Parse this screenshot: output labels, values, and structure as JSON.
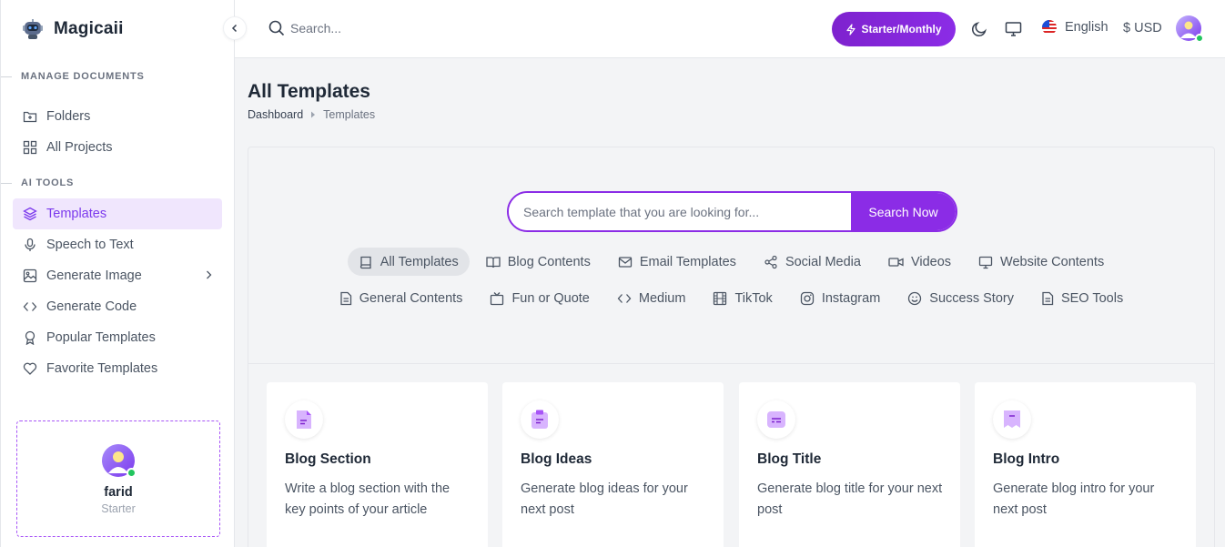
{
  "brand": {
    "name": "Magicaii"
  },
  "sidebar": {
    "section_documents": "MANAGE DOCUMENTS",
    "documents": [
      {
        "label": "Folders",
        "icon": "folder-plus-icon"
      },
      {
        "label": "All Projects",
        "icon": "grid-icon"
      }
    ],
    "section_ai_tools": "AI TOOLS",
    "tools": [
      {
        "label": "Templates",
        "icon": "layers-icon",
        "active": true
      },
      {
        "label": "Speech to Text",
        "icon": "microphone-icon"
      },
      {
        "label": "Generate Image",
        "icon": "image-icon"
      },
      {
        "label": "Generate Code",
        "icon": "code-icon"
      },
      {
        "label": "Popular Templates",
        "icon": "award-icon"
      },
      {
        "label": "Favorite Templates",
        "icon": "heart-icon"
      }
    ],
    "user": {
      "name": "farid",
      "plan": "Starter"
    }
  },
  "topbar": {
    "search_placeholder": "Search...",
    "plan_button": "Starter/Monthly",
    "language": "English",
    "currency": "$ USD"
  },
  "page": {
    "title": "All Templates",
    "breadcrumb_home": "Dashboard",
    "breadcrumb_current": "Templates"
  },
  "template_search": {
    "placeholder": "Search template that you are looking for...",
    "button": "Search Now"
  },
  "categories_row1": [
    {
      "label": "All Templates",
      "icon": "book-icon",
      "active": true
    },
    {
      "label": "Blog Contents",
      "icon": "book-open-icon"
    },
    {
      "label": "Email Templates",
      "icon": "mail-icon"
    },
    {
      "label": "Social Media",
      "icon": "share-icon"
    },
    {
      "label": "Videos",
      "icon": "video-icon"
    },
    {
      "label": "Website Contents",
      "icon": "monitor-icon"
    }
  ],
  "categories_row2": [
    {
      "label": "General Contents",
      "icon": "file-text-icon"
    },
    {
      "label": "Fun or Quote",
      "icon": "tv-icon"
    },
    {
      "label": "Medium",
      "icon": "code-icon"
    },
    {
      "label": "TikTok",
      "icon": "film-icon"
    },
    {
      "label": "Instagram",
      "icon": "instagram-icon"
    },
    {
      "label": "Success Story",
      "icon": "smile-icon"
    },
    {
      "label": "SEO Tools",
      "icon": "file-text-icon"
    }
  ],
  "cards": [
    {
      "title": "Blog Section",
      "desc": "Write a blog section with the key points of your article"
    },
    {
      "title": "Blog Ideas",
      "desc": "Generate blog ideas for your next post"
    },
    {
      "title": "Blog Title",
      "desc": "Generate blog title for your next post"
    },
    {
      "title": "Blog Intro",
      "desc": "Generate blog intro for your next post"
    }
  ],
  "colors": {
    "accent": "#8b2ce6",
    "active_bg": "#f0e6fd",
    "card_icon": "#c084fc"
  }
}
